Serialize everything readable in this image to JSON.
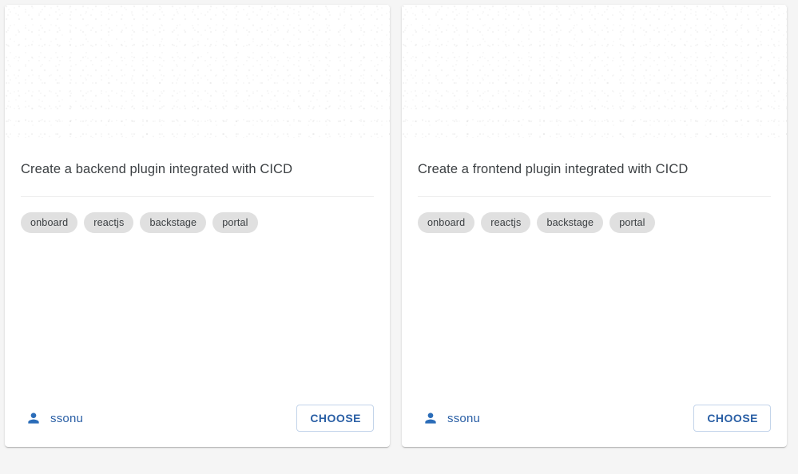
{
  "theme": {
    "page_background": "#f5f5f5",
    "card_background": "#ffffff",
    "accent_blue": "#2a5fa5",
    "chip_background": "#e0e0e0",
    "title_color": "#3c4043",
    "divider_color": "#ececec",
    "button_border": "#c3d4ea"
  },
  "cards": [
    {
      "title": "Create a backend plugin integrated with CICD",
      "tags": [
        "onboard",
        "reactjs",
        "backstage",
        "portal"
      ],
      "owner": {
        "icon": "person-icon",
        "name": "ssonu"
      },
      "action": {
        "label": "CHOOSE"
      }
    },
    {
      "title": "Create a frontend plugin integrated with CICD",
      "tags": [
        "onboard",
        "reactjs",
        "backstage",
        "portal"
      ],
      "owner": {
        "icon": "person-icon",
        "name": "ssonu"
      },
      "action": {
        "label": "CHOOSE"
      }
    }
  ]
}
